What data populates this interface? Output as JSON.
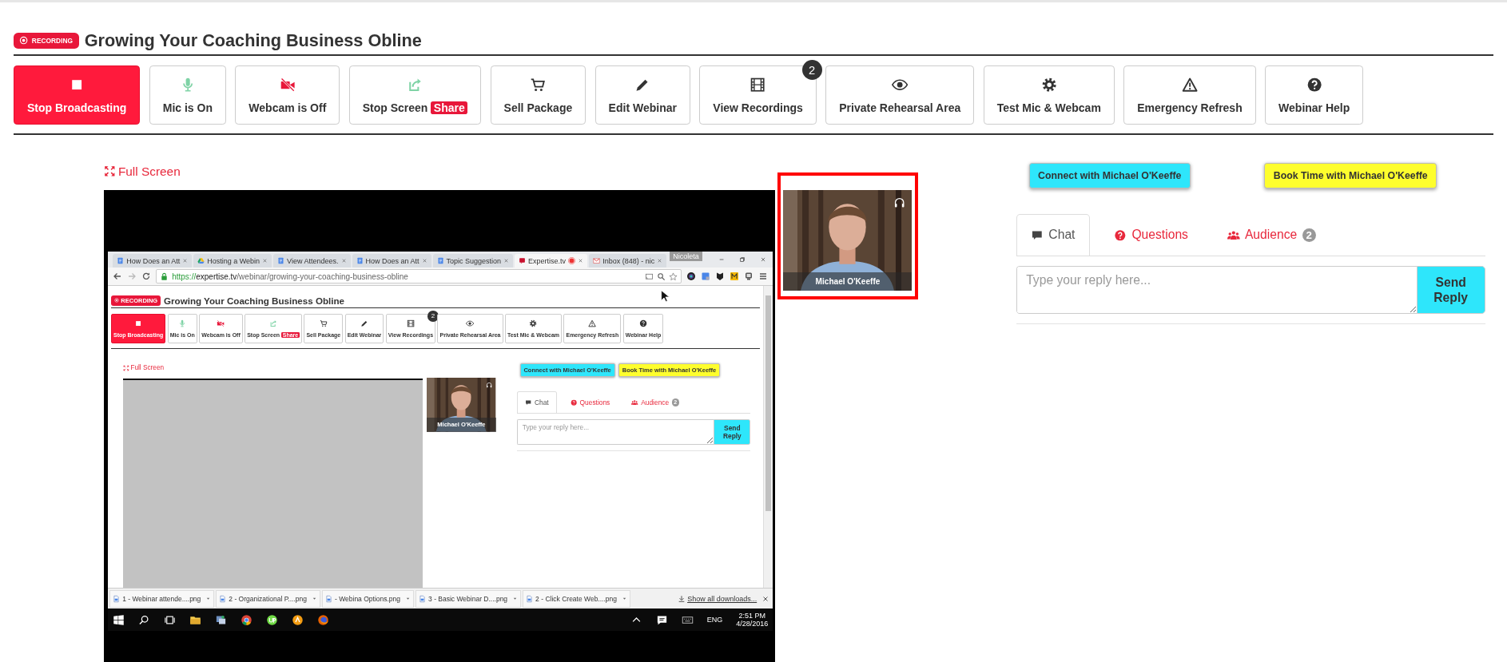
{
  "header": {
    "badge": "RECORDING",
    "title": "Growing Your Coaching Business Obline"
  },
  "toolbar": [
    {
      "kind": "stop",
      "label": "Stop Broadcasting",
      "active": true
    },
    {
      "kind": "mic",
      "label": "Mic is On",
      "active": false
    },
    {
      "kind": "webcam-off",
      "label": "Webcam is Off",
      "active": false
    },
    {
      "kind": "share",
      "label": "Stop Screen",
      "tag": "Share",
      "active": false
    },
    {
      "kind": "cart",
      "label": "Sell Package",
      "active": false
    },
    {
      "kind": "pencil",
      "label": "Edit Webinar",
      "active": false
    },
    {
      "kind": "film",
      "label": "View Recordings",
      "badge": "2",
      "active": false
    },
    {
      "kind": "eye",
      "label": "Private Rehearsal Area",
      "active": false
    },
    {
      "kind": "gear",
      "label": "Test Mic & Webcam",
      "active": false
    },
    {
      "kind": "warning",
      "label": "Emergency Refresh",
      "active": false
    },
    {
      "kind": "help",
      "label": "Webinar Help",
      "active": false
    }
  ],
  "full_screen": "Full Screen",
  "video": {
    "kind": "screen_share",
    "screen_share": {
      "browser_tabs": [
        {
          "kind": "doc",
          "label": "How Does an Att",
          "selected": false,
          "recording": false
        },
        {
          "kind": "drive",
          "label": "Hosting a Webin",
          "selected": false,
          "recording": false
        },
        {
          "kind": "doc",
          "label": "View Attendees.",
          "selected": false,
          "recording": false
        },
        {
          "kind": "doc",
          "label": "How Does an Att",
          "selected": false,
          "recording": false
        },
        {
          "kind": "doc",
          "label": "Topic Suggestion",
          "selected": false,
          "recording": false
        },
        {
          "kind": "site",
          "label": "Expertise.tv",
          "selected": true,
          "recording": true
        },
        {
          "kind": "mail",
          "label": "Inbox (848) - nic",
          "selected": false,
          "recording": false
        }
      ],
      "window_user": "Nicoleta",
      "url": {
        "scheme": "https://",
        "host": "expertise.tv",
        "path": "/webinar/growing-your-coaching-business-obline"
      },
      "page": {
        "header": {
          "badge": "RECORDING",
          "title": "Growing Your Coaching Business Obline"
        },
        "toolbar": [
          {
            "kind": "stop",
            "label": "Stop Broadcasting",
            "active": true
          },
          {
            "kind": "mic",
            "label": "Mic is On",
            "active": false
          },
          {
            "kind": "webcam-off",
            "label": "Webcam is Off",
            "active": false
          },
          {
            "kind": "share",
            "label": "Stop Screen",
            "tag": "Share",
            "active": false
          },
          {
            "kind": "cart",
            "label": "Sell Package",
            "active": false
          },
          {
            "kind": "pencil",
            "label": "Edit Webinar",
            "active": false
          },
          {
            "kind": "film",
            "label": "View Recordings",
            "badge": "2",
            "active": false
          },
          {
            "kind": "eye",
            "label": "Private Rehearsal Area",
            "active": false
          },
          {
            "kind": "gear",
            "label": "Test Mic & Webcam",
            "active": false
          },
          {
            "kind": "warning",
            "label": "Emergency Refresh",
            "active": false
          },
          {
            "kind": "help",
            "label": "Webinar Help",
            "active": false
          }
        ],
        "full_screen": "Full Screen",
        "video": {
          "kind": "blank"
        },
        "webcam": {
          "name": "Michael O'Keeffe",
          "highlighted": false
        },
        "actions": [
          {
            "label": "Connect with Michael O'Keeffe",
            "color": "#2ee6fb"
          },
          {
            "label": "Book Time with Michael O'Keeffe",
            "color": "#fefe2d"
          }
        ],
        "tabs": [
          {
            "kind": "chat",
            "label": "Chat",
            "selected": true
          },
          {
            "kind": "questions",
            "label": "Questions",
            "selected": false
          },
          {
            "kind": "audience",
            "label": "Audience",
            "badge": "2",
            "selected": false
          }
        ],
        "reply": {
          "placeholder": "Type your reply here...",
          "button": "Send Reply"
        }
      },
      "downloads": [
        "1 - Webinar attende....png",
        "2 - Organizational P....png",
        "- Webina Options.png",
        "3 - Basic Webinar D....png",
        "2 - Click Create Web....png"
      ],
      "show_all": "Show all downloads...",
      "taskbar": {
        "language": "ENG",
        "time": "2:51 PM",
        "date": "4/28/2016"
      }
    }
  },
  "webcam": {
    "name": "Michael O'Keeffe",
    "highlighted": true
  },
  "actions": [
    {
      "label": "Connect with Michael O'Keeffe",
      "color": "#2ee6fb"
    },
    {
      "label": "Book Time with Michael O'Keeffe",
      "color": "#fefe2d"
    }
  ],
  "tabs": [
    {
      "kind": "chat",
      "label": "Chat",
      "selected": true
    },
    {
      "kind": "questions",
      "label": "Questions",
      "selected": false
    },
    {
      "kind": "audience",
      "label": "Audience",
      "badge": "2",
      "selected": false
    }
  ],
  "reply": {
    "placeholder": "Type your reply here...",
    "button": "Send Reply"
  }
}
